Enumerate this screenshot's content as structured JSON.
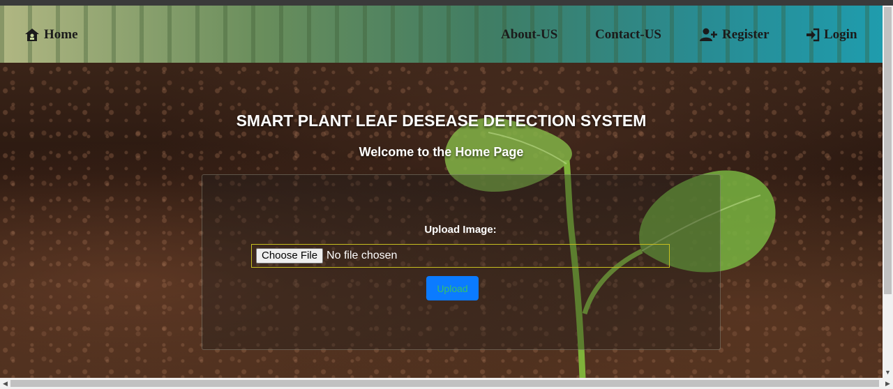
{
  "nav": {
    "home": "Home",
    "about": "About-US",
    "contact": "Contact-US",
    "register": "Register",
    "login": "Login"
  },
  "hero": {
    "title": "SMART PLANT LEAF DESEASE DETECTION SYSTEM",
    "subtitle": "Welcome to the Home Page"
  },
  "upload": {
    "label": "Upload Image:",
    "choose_button": "Choose File",
    "file_status": "No file chosen",
    "submit_button": "Upload"
  },
  "icons": {
    "home": "home-icon",
    "register": "user-plus-icon",
    "login": "sign-in-icon"
  },
  "colors": {
    "upload_button_bg": "#0b7bff",
    "upload_button_text": "#35c26a",
    "file_box_border": "#c8c020"
  }
}
